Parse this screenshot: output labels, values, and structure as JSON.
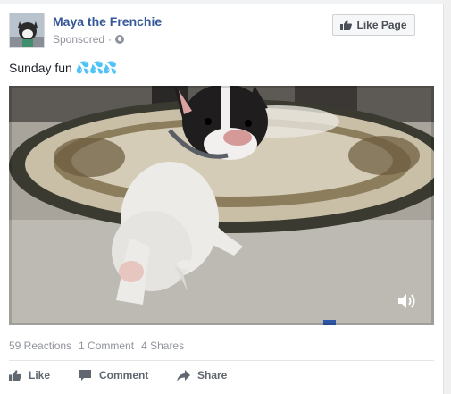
{
  "post": {
    "page_name": "Maya the Frenchie",
    "sponsored_label": "Sponsored",
    "meta_separator": "·",
    "like_page_label": "Like Page",
    "text": "Sunday fun",
    "text_emoji": "💦💦💦"
  },
  "stats": {
    "reactions": "59 Reactions",
    "comments": "1 Comment",
    "shares": "4 Shares"
  },
  "actions": {
    "like": "Like",
    "comment": "Comment",
    "share": "Share"
  },
  "colors": {
    "page_name": "#365899",
    "meta": "#90949c",
    "action_text": "#616770",
    "button_bg": "#f6f7f9"
  },
  "icons": {
    "like_page": "thumbs-up-icon",
    "privacy": "globe-icon",
    "volume": "volume-icon",
    "like": "thumbs-up-icon",
    "comment": "comment-icon",
    "share": "share-arrow-icon"
  }
}
